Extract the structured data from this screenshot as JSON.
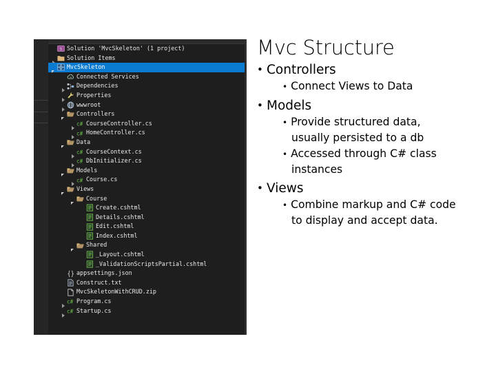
{
  "slide": {
    "title": "Mvc Structure",
    "bullet_glyph": "•",
    "bullets": [
      {
        "level": 1,
        "text": "Controllers",
        "children": [
          {
            "level": 2,
            "text": "Connect Views to Data"
          }
        ]
      },
      {
        "level": 1,
        "text": "Models",
        "children": [
          {
            "level": 2,
            "text": "Provide structured data, usually persisted to a db"
          },
          {
            "level": 2,
            "text": "Accessed through C# class instances"
          }
        ]
      },
      {
        "level": 1,
        "text": "Views",
        "children": [
          {
            "level": 2,
            "text": "Combine markup and C# code to display and accept data."
          }
        ]
      }
    ]
  },
  "solution_explorer": {
    "selected_item": "MvcSkeleton",
    "selection_color": "#0b7ad1",
    "background_color": "#1e1e1e",
    "text_color": "#e8e8e8",
    "folder_color": "#dcb67a",
    "csharp_color": "#6cc24a",
    "rows": [
      {
        "indent": 0,
        "expander": "none",
        "icon": "solution-icon",
        "label": "Solution 'MvcSkeleton' (1 project)",
        "selected": false
      },
      {
        "indent": 0,
        "expander": "collapsed",
        "icon": "folder-icon",
        "label": "Solution Items",
        "selected": false
      },
      {
        "indent": 0,
        "expander": "expanded",
        "icon": "project-icon",
        "label": "MvcSkeleton",
        "selected": true
      },
      {
        "indent": 1,
        "expander": "none",
        "icon": "connected-services-icon",
        "label": "Connected Services",
        "selected": false
      },
      {
        "indent": 1,
        "expander": "collapsed",
        "icon": "dependencies-icon",
        "label": "Dependencies",
        "selected": false
      },
      {
        "indent": 1,
        "expander": "collapsed",
        "icon": "wrench-icon",
        "label": "Properties",
        "selected": false
      },
      {
        "indent": 1,
        "expander": "collapsed",
        "icon": "globe-icon",
        "label": "wwwroot",
        "selected": false
      },
      {
        "indent": 1,
        "expander": "expanded",
        "icon": "folder-open-icon",
        "label": "Controllers",
        "selected": false
      },
      {
        "indent": 2,
        "expander": "collapsed",
        "icon": "csharp-icon",
        "label": "CourseController.cs",
        "selected": false
      },
      {
        "indent": 2,
        "expander": "collapsed",
        "icon": "csharp-icon",
        "label": "HomeController.cs",
        "selected": false
      },
      {
        "indent": 1,
        "expander": "expanded",
        "icon": "folder-open-icon",
        "label": "Data",
        "selected": false
      },
      {
        "indent": 2,
        "expander": "collapsed",
        "icon": "csharp-icon",
        "label": "CourseContext.cs",
        "selected": false
      },
      {
        "indent": 2,
        "expander": "collapsed",
        "icon": "csharp-icon",
        "label": "DbInitializer.cs",
        "selected": false
      },
      {
        "indent": 1,
        "expander": "expanded",
        "icon": "folder-open-icon",
        "label": "Models",
        "selected": false
      },
      {
        "indent": 2,
        "expander": "collapsed",
        "icon": "csharp-icon",
        "label": "Course.cs",
        "selected": false
      },
      {
        "indent": 1,
        "expander": "expanded",
        "icon": "folder-open-icon",
        "label": "Views",
        "selected": false
      },
      {
        "indent": 2,
        "expander": "expanded",
        "icon": "folder-open-icon",
        "label": "Course",
        "selected": false
      },
      {
        "indent": 3,
        "expander": "none",
        "icon": "cshtml-icon",
        "label": "Create.cshtml",
        "selected": false
      },
      {
        "indent": 3,
        "expander": "none",
        "icon": "cshtml-icon",
        "label": "Details.cshtml",
        "selected": false
      },
      {
        "indent": 3,
        "expander": "none",
        "icon": "cshtml-icon",
        "label": "Edit.cshtml",
        "selected": false
      },
      {
        "indent": 3,
        "expander": "none",
        "icon": "cshtml-icon",
        "label": "Index.cshtml",
        "selected": false
      },
      {
        "indent": 2,
        "expander": "expanded",
        "icon": "folder-open-icon",
        "label": "Shared",
        "selected": false
      },
      {
        "indent": 3,
        "expander": "none",
        "icon": "cshtml-icon",
        "label": "_Layout.cshtml",
        "selected": false
      },
      {
        "indent": 3,
        "expander": "none",
        "icon": "cshtml-icon",
        "label": "_ValidationScriptsPartial.cshtml",
        "selected": false
      },
      {
        "indent": 1,
        "expander": "none",
        "icon": "json-icon",
        "label": "appsettings.json",
        "selected": false
      },
      {
        "indent": 1,
        "expander": "none",
        "icon": "text-file-icon",
        "label": "Construct.txt",
        "selected": false
      },
      {
        "indent": 1,
        "expander": "none",
        "icon": "zip-file-icon",
        "label": "MvcSkeletonWithCRUD.zip",
        "selected": false
      },
      {
        "indent": 1,
        "expander": "collapsed",
        "icon": "csharp-icon",
        "label": "Program.cs",
        "selected": false
      },
      {
        "indent": 1,
        "expander": "collapsed",
        "icon": "csharp-icon",
        "label": "Startup.cs",
        "selected": false
      }
    ]
  }
}
